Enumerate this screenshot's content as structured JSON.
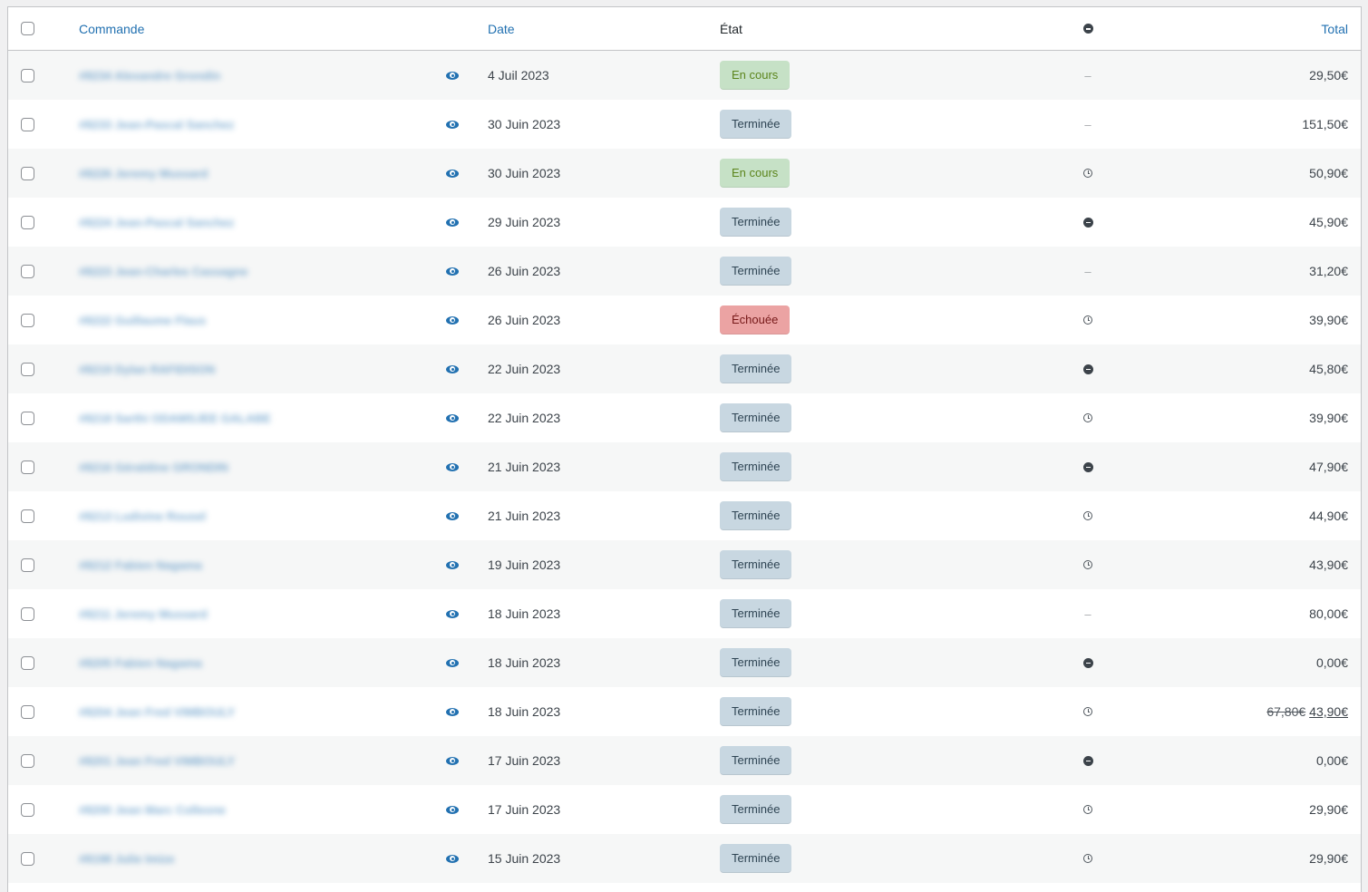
{
  "header": {
    "order": "Commande",
    "date": "Date",
    "state": "État",
    "origin_icon": "origin-icon",
    "total": "Total"
  },
  "status_labels": {
    "processing": "En cours",
    "completed": "Terminée",
    "failed": "Échouée"
  },
  "orders": [
    {
      "name": "#8234 Alexandre Grondin",
      "date": "4 Juil 2023",
      "status": "processing",
      "status_label": "En cours",
      "origin": "dash",
      "total": "29,50€"
    },
    {
      "name": "#8233 Jean-Pascal Sanchez",
      "date": "30 Juin 2023",
      "status": "completed",
      "status_label": "Terminée",
      "origin": "dash",
      "total": "151,50€"
    },
    {
      "name": "#8226 Jeremy Mussard",
      "date": "30 Juin 2023",
      "status": "processing",
      "status_label": "En cours",
      "origin": "history",
      "total": "50,90€"
    },
    {
      "name": "#8224 Jean-Pascal Sanchez",
      "date": "29 Juin 2023",
      "status": "completed",
      "status_label": "Terminée",
      "origin": "origin",
      "total": "45,90€"
    },
    {
      "name": "#8223 Jean-Charles Cassagne",
      "date": "26 Juin 2023",
      "status": "completed",
      "status_label": "Terminée",
      "origin": "dash",
      "total": "31,20€"
    },
    {
      "name": "#8222 Guillaume Flaus",
      "date": "26 Juin 2023",
      "status": "failed",
      "status_label": "Échouée",
      "origin": "history",
      "total": "39,90€"
    },
    {
      "name": "#8219 Dylan RAFIDISON",
      "date": "22 Juin 2023",
      "status": "completed",
      "status_label": "Terminée",
      "origin": "origin",
      "total": "45,80€"
    },
    {
      "name": "#8218 Sarthi ODAMSJEE GALABE",
      "date": "22 Juin 2023",
      "status": "completed",
      "status_label": "Terminée",
      "origin": "history",
      "total": "39,90€"
    },
    {
      "name": "#8216 Géraldine GRONDIN",
      "date": "21 Juin 2023",
      "status": "completed",
      "status_label": "Terminée",
      "origin": "origin",
      "total": "47,90€"
    },
    {
      "name": "#8213 Ludivine Rousel",
      "date": "21 Juin 2023",
      "status": "completed",
      "status_label": "Terminée",
      "origin": "history",
      "total": "44,90€"
    },
    {
      "name": "#8212 Fabien Nagama",
      "date": "19 Juin 2023",
      "status": "completed",
      "status_label": "Terminée",
      "origin": "history",
      "total": "43,90€"
    },
    {
      "name": "#8211 Jeremy Mussard",
      "date": "18 Juin 2023",
      "status": "completed",
      "status_label": "Terminée",
      "origin": "dash",
      "total": "80,00€"
    },
    {
      "name": "#8205 Fabien Nagama",
      "date": "18 Juin 2023",
      "status": "completed",
      "status_label": "Terminée",
      "origin": "origin",
      "total": "0,00€"
    },
    {
      "name": "#8204 Jean Fred VIMBOULY",
      "date": "18 Juin 2023",
      "status": "completed",
      "status_label": "Terminée",
      "origin": "history",
      "total_old": "67,80€",
      "total": "43,90€"
    },
    {
      "name": "#8201 Jean Fred VIMBOULY",
      "date": "17 Juin 2023",
      "status": "completed",
      "status_label": "Terminée",
      "origin": "origin",
      "total": "0,00€"
    },
    {
      "name": "#8200 Jean Marc Colleone",
      "date": "17 Juin 2023",
      "status": "completed",
      "status_label": "Terminée",
      "origin": "history",
      "total": "29,90€"
    },
    {
      "name": "#8198 Julie Imize",
      "date": "15 Juin 2023",
      "status": "completed",
      "status_label": "Terminée",
      "origin": "history",
      "total": "29,90€"
    }
  ],
  "dash_text": "–"
}
